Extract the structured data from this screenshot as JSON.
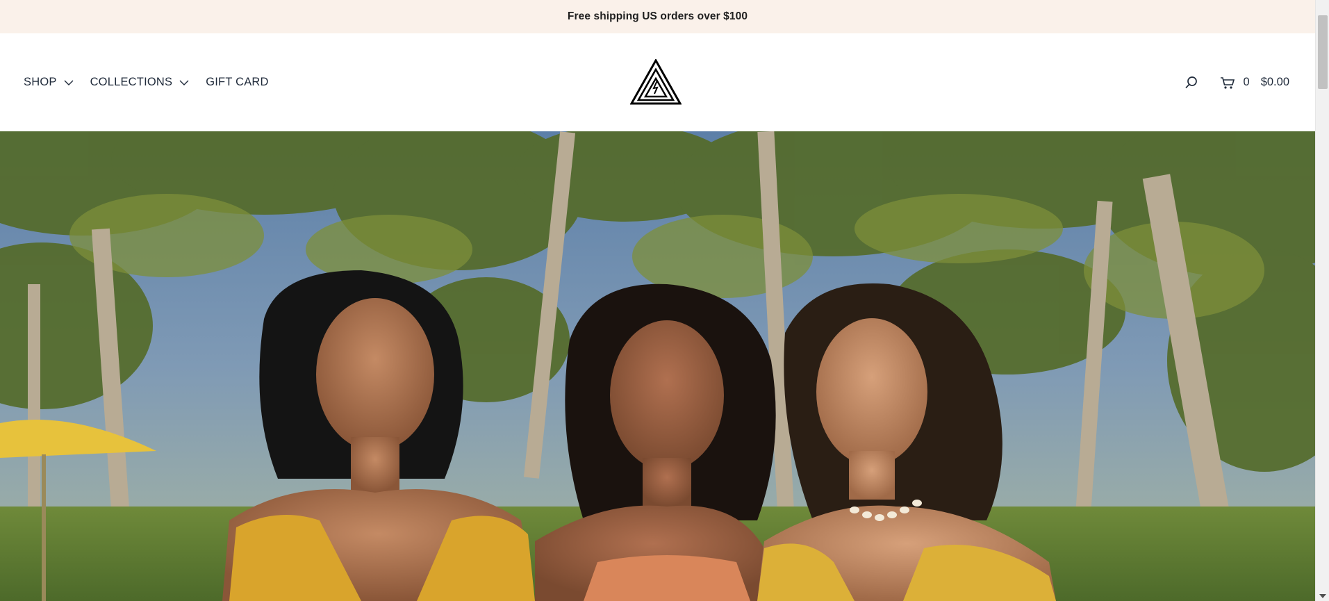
{
  "announcement": {
    "text": "Free shipping US orders over $100"
  },
  "nav": {
    "items": [
      {
        "label": "SHOP",
        "has_dropdown": true
      },
      {
        "label": "COLLECTIONS",
        "has_dropdown": true
      },
      {
        "label": "GIFT CARD",
        "has_dropdown": false
      }
    ]
  },
  "header": {
    "logo_icon": "triangle-logo-icon",
    "search_icon": "search-icon",
    "cart_icon": "cart-icon",
    "cart_count": "0",
    "cart_total": "$0.00"
  },
  "hero": {
    "image_description_icon": "hero-image"
  },
  "colors": {
    "announcement_bg": "#faf1ea",
    "text": "#1f2a3a"
  }
}
